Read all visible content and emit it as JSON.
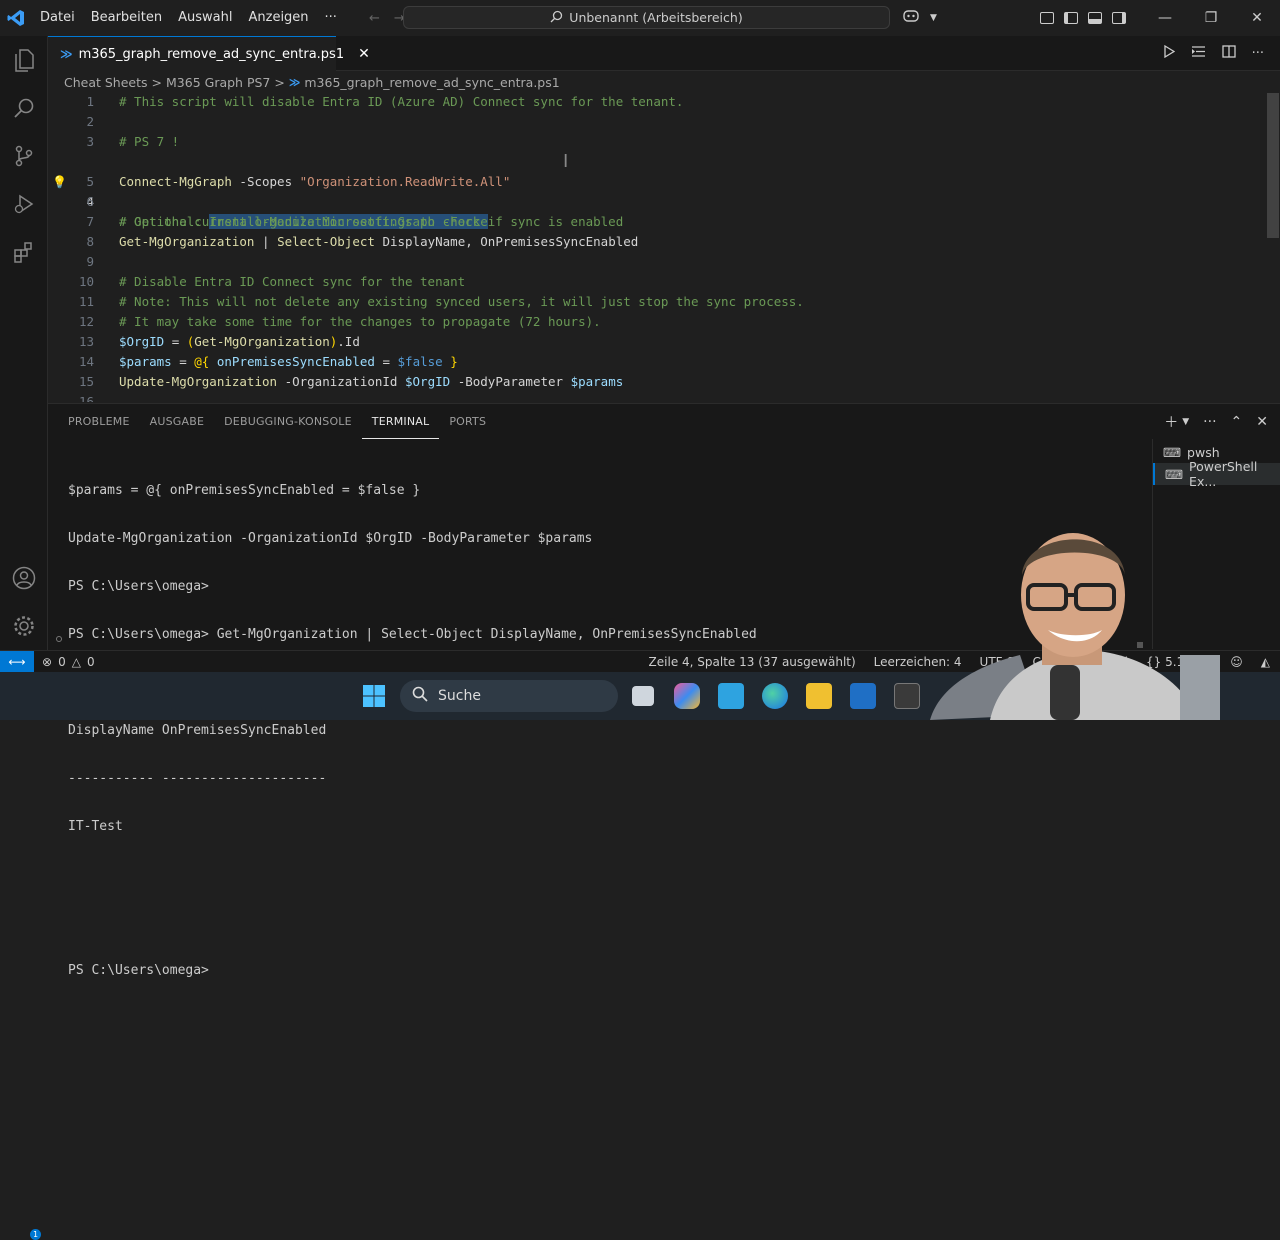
{
  "titlebar": {
    "menu": [
      "Datei",
      "Bearbeiten",
      "Auswahl",
      "Anzeigen",
      "···"
    ],
    "command_center": "Unbenannt (Arbeitsbereich)"
  },
  "tab": {
    "label": "m365_graph_remove_ad_sync_entra.ps1"
  },
  "breadcrumb": {
    "parts": [
      "Cheat Sheets",
      "M365 Graph PS7",
      "m365_graph_remove_ad_sync_entra.ps1"
    ],
    "sep": ">"
  },
  "editor": {
    "line_numbers": [
      "1",
      "2",
      "3",
      "4",
      "5",
      "6",
      "7",
      "8",
      "9",
      "10",
      "11",
      "12",
      "13",
      "14",
      "15",
      "16"
    ],
    "current_line": "4",
    "l1": "# This script will disable Entra ID (Azure AD) Connect sync for the tenant.",
    "l3": "# PS 7 !",
    "l4_prefix": "# Optional: ",
    "l4_selected": "Install-Module Microsoft.Graph -Force",
    "l5_cmd": "Connect-MgGraph",
    "l5_param": "-Scopes",
    "l5_str": "\"Organization.ReadWrite.All\"",
    "l7": "# Get the current organization settings to check if sync is enabled",
    "l8_cmd": "Get-MgOrganization",
    "l8_pipe": "|",
    "l8_cmd2": "Select-Object",
    "l8_args": "DisplayName, OnPremisesSyncEnabled",
    "l10": "# Disable Entra ID Connect sync for the tenant",
    "l11": "# Note: This will not delete any existing synced users, it will just stop the sync process.",
    "l12": "# It may take some time for the changes to propagate (72 hours).",
    "l13_var": "$OrgID",
    "l13_eq": "=",
    "l13_open": "(",
    "l13_cmd": "Get-MgOrganization",
    "l13_close": ")",
    "l13_prop": ".Id",
    "l14_var": "$params",
    "l14_eq": "=",
    "l14_open": "@{",
    "l14_key": "onPremisesSyncEnabled",
    "l14_eq2": "=",
    "l14_val": "$false",
    "l14_close": "}",
    "l15_cmd": "Update-MgOrganization",
    "l15_p1": "-OrganizationId",
    "l15_v1": "$OrgID",
    "l15_p2": "-BodyParameter",
    "l15_v2": "$params"
  },
  "panel": {
    "tabs": [
      "PROBLEME",
      "AUSGABE",
      "DEBUGGING-KONSOLE",
      "TERMINAL",
      "PORTS"
    ],
    "active_tab": "TERMINAL",
    "terminal_lines": [
      "$params = @{ onPremisesSyncEnabled = $false }",
      "Update-MgOrganization -OrganizationId $OrgID -BodyParameter $params",
      "PS C:\\Users\\omega>",
      "PS C:\\Users\\omega> Get-MgOrganization | Select-Object DisplayName, OnPremisesSyncEnabled",
      "",
      "DisplayName OnPremisesSyncEnabled",
      "----------- ---------------------",
      "IT-Test",
      "",
      "",
      "PS C:\\Users\\omega>"
    ],
    "terminal_list": [
      "pwsh",
      "PowerShell Ex..."
    ]
  },
  "statusbar": {
    "errors": "0",
    "warnings": "0",
    "position": "Zeile 4, Spalte 13 (37 ausgewählt)",
    "spaces": "Leerzeichen: 4",
    "encoding": "UTF-8",
    "eol": "CRL",
    "shell": "ell",
    "version": "5.1"
  },
  "taskbar": {
    "search": "Suche"
  },
  "activity_badge": "1"
}
